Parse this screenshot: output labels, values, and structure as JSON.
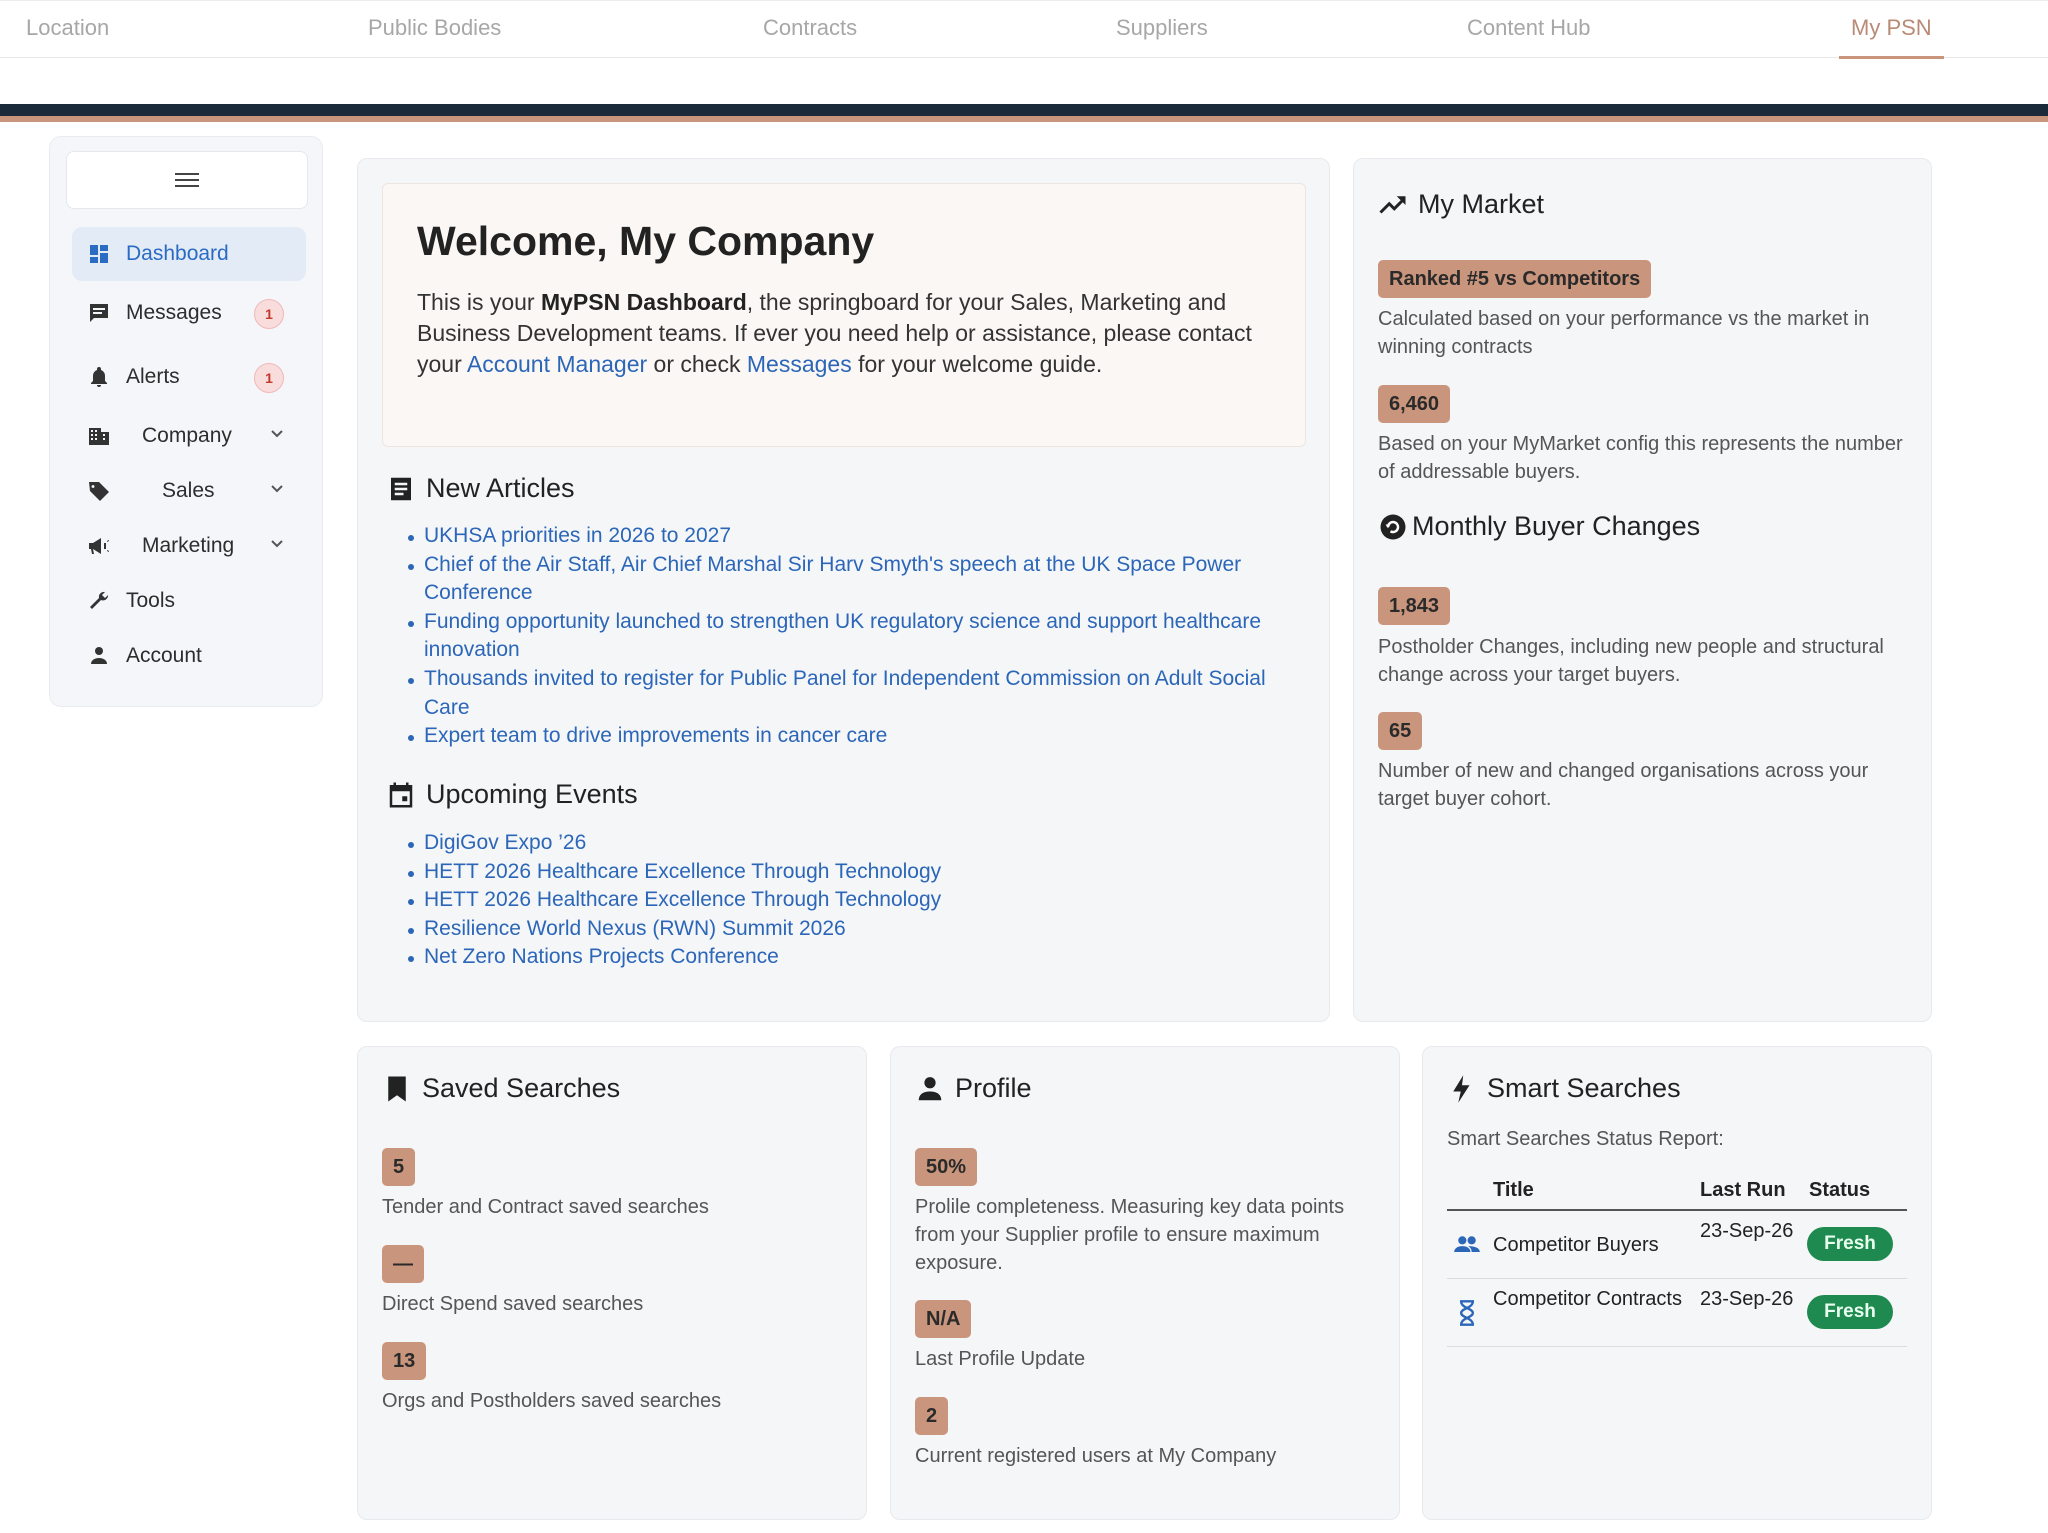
{
  "topnav": {
    "items": [
      "Location",
      "Public Bodies",
      "Contracts",
      "Suppliers",
      "Content Hub",
      "My PSN"
    ],
    "active": "My PSN"
  },
  "colors": {
    "accent": "#c9957c",
    "dark_bar": "#1b2a3b",
    "link": "#2b66b8",
    "fresh": "#1f8a4f"
  },
  "sidebar": {
    "items": [
      {
        "label": "Dashboard",
        "icon": "dashboard-icon"
      },
      {
        "label": "Messages",
        "icon": "message-icon",
        "badge": "1"
      },
      {
        "label": "Alerts",
        "icon": "bell-icon",
        "badge": "1"
      },
      {
        "label": "Company",
        "icon": "building-icon"
      },
      {
        "label": "Sales",
        "icon": "tag-icon"
      },
      {
        "label": "Marketing",
        "icon": "megaphone-icon"
      },
      {
        "label": "Tools",
        "icon": "wrench-icon"
      },
      {
        "label": "Account",
        "icon": "person-icon"
      }
    ]
  },
  "welcome": {
    "title": "Welcome, My Company",
    "text_1": "This is your ",
    "bold": "MyPSN Dashboard",
    "text_2": ", the springboard for your Sales, Marketing and Business Development teams. If ever you need help or assistance, please contact your ",
    "link_1": "Account Manager",
    "text_3": " or check ",
    "link_2": "Messages",
    "text_4": " for your welcome guide."
  },
  "articles": {
    "heading": "New Articles",
    "items": [
      "UKHSA priorities in 2026 to 2027",
      "Chief of the Air Staff, Air Chief Marshal Sir Harv Smyth's speech at the UK Space Power Conference",
      "Funding opportunity launched to strengthen UK regulatory science and support healthcare innovation",
      "Thousands invited to register for Public Panel for Independent Commission on Adult Social Care",
      "Expert team to drive improvements in cancer care"
    ]
  },
  "events": {
    "heading": "Upcoming Events",
    "items": [
      "DigiGov Expo ’26",
      "HETT 2026 Healthcare Excellence Through Technology",
      "HETT 2026 Healthcare Excellence Through Technology",
      "Resilience World Nexus (RWN) Summit 2026",
      "Net Zero Nations Projects Conference"
    ]
  },
  "market": {
    "heading": "My Market",
    "rank": "Ranked #5 vs Competitors",
    "rank_desc": "Calculated based on your performance vs the market in winning contracts",
    "buyers": "6,460",
    "buyers_desc": "Based on your MyMarket config this represents the number of addressable buyers.",
    "changes_heading": "Monthly Buyer Changes",
    "postholder": "1,843",
    "postholder_desc": "Postholder Changes, including new people and structural change across your target buyers.",
    "orgs": "65",
    "orgs_desc": "Number of new and changed organisations across your target buyer cohort."
  },
  "saved": {
    "heading": "Saved Searches",
    "tender": "5",
    "tender_desc": "Tender and Contract saved searches",
    "direct": "—",
    "direct_desc": "Direct Spend saved searches",
    "orgs": "13",
    "orgs_desc": "Orgs and Postholders saved searches"
  },
  "profile": {
    "heading": "Profile",
    "completeness": "50%",
    "completeness_desc": "Prolile completeness. Measuring key data points from your Supplier profile to ensure maximum exposure.",
    "last_update": "N/A",
    "last_update_desc": "Last Profile Update",
    "users": "2",
    "users_desc": "Current registered users at My Company"
  },
  "smart": {
    "heading": "Smart Searches",
    "subtitle": "Smart Searches Status Report:",
    "columns": [
      "Title",
      "Last Run",
      "Status"
    ],
    "rows": [
      {
        "title": "Competitor Buyers",
        "last_run": "23-Sep-26",
        "status": "Fresh",
        "icon": "people-icon"
      },
      {
        "title": "Competitor Contracts",
        "last_run": "23-Sep-26",
        "status": "Fresh",
        "icon": "hourglass-icon"
      }
    ]
  }
}
